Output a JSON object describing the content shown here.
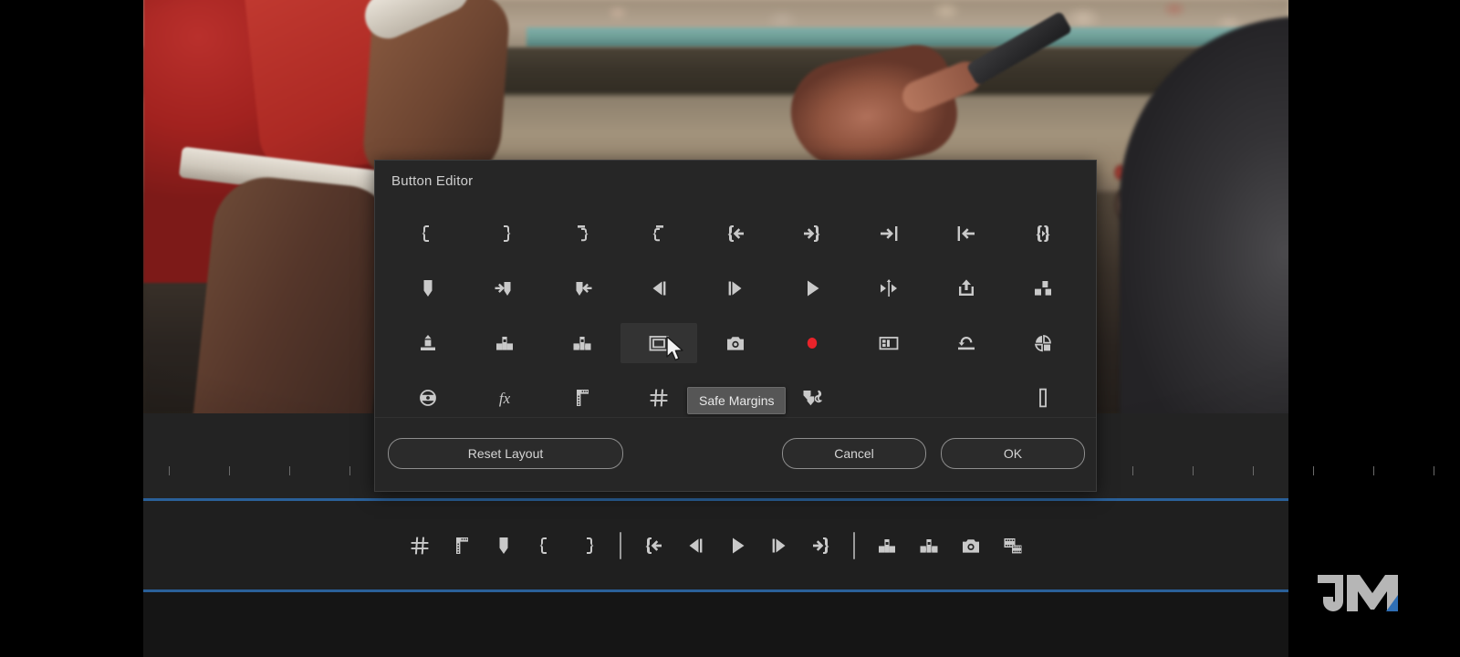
{
  "app": {
    "title": "Button Editor",
    "accent_blue": "#2a6099",
    "panel_bg": "#262626",
    "record_red": "#e8232a"
  },
  "dialog": {
    "title": "Button Editor",
    "tooltip": "Safe Margins",
    "buttons": {
      "reset": "Reset Layout",
      "cancel": "Cancel",
      "ok": "OK"
    },
    "rows": [
      [
        {
          "icon": "mark-in"
        },
        {
          "icon": "mark-out"
        },
        {
          "icon": "mark-clip-out"
        },
        {
          "icon": "mark-clip-in"
        },
        {
          "icon": "go-to-in"
        },
        {
          "icon": "go-to-out"
        },
        {
          "icon": "go-to-next-edit"
        },
        {
          "icon": "go-to-previous-edit"
        },
        {
          "icon": "mark-selection"
        }
      ],
      [
        {
          "icon": "add-marker"
        },
        {
          "icon": "go-to-next-marker"
        },
        {
          "icon": "go-to-previous-marker"
        },
        {
          "icon": "step-back"
        },
        {
          "icon": "step-forward"
        },
        {
          "icon": "play-stop-toggle"
        },
        {
          "icon": "play-in-to-out"
        },
        {
          "icon": "export-frame"
        },
        {
          "icon": "lift"
        }
      ],
      [
        {
          "icon": "extract"
        },
        {
          "icon": "insert"
        },
        {
          "icon": "overwrite"
        },
        {
          "icon": "safe-margins",
          "hover": true
        },
        {
          "icon": "camera"
        },
        {
          "icon": "record"
        },
        {
          "icon": "comparison-view"
        },
        {
          "icon": "loop-playback"
        },
        {
          "icon": "multi-camera"
        }
      ],
      [
        {
          "icon": "global-fx-mute"
        },
        {
          "icon": "effects-fx"
        },
        {
          "icon": "settings-ruler"
        },
        {
          "icon": "grid-overlay"
        },
        {
          "icon": "safe-margins-alt"
        },
        {
          "icon": "marker-link"
        },
        {
          "icon": "empty"
        },
        {
          "icon": "empty"
        },
        {
          "icon": "vertical-bar"
        }
      ]
    ]
  },
  "toolbar": {
    "items": [
      {
        "icon": "grid-overlay"
      },
      {
        "icon": "settings-ruler"
      },
      {
        "icon": "add-marker"
      },
      {
        "icon": "mark-in"
      },
      {
        "icon": "mark-out"
      },
      {
        "icon": "separator"
      },
      {
        "icon": "go-to-in"
      },
      {
        "icon": "step-back"
      },
      {
        "icon": "play-stop-toggle"
      },
      {
        "icon": "step-forward"
      },
      {
        "icon": "go-to-out"
      },
      {
        "icon": "separator"
      },
      {
        "icon": "insert"
      },
      {
        "icon": "overwrite"
      },
      {
        "icon": "camera"
      },
      {
        "icon": "export-frame-filmstrip"
      }
    ]
  },
  "watermark": {
    "text": "JM",
    "gray": "#b6b6b6",
    "blue": "#2f6fb5"
  }
}
